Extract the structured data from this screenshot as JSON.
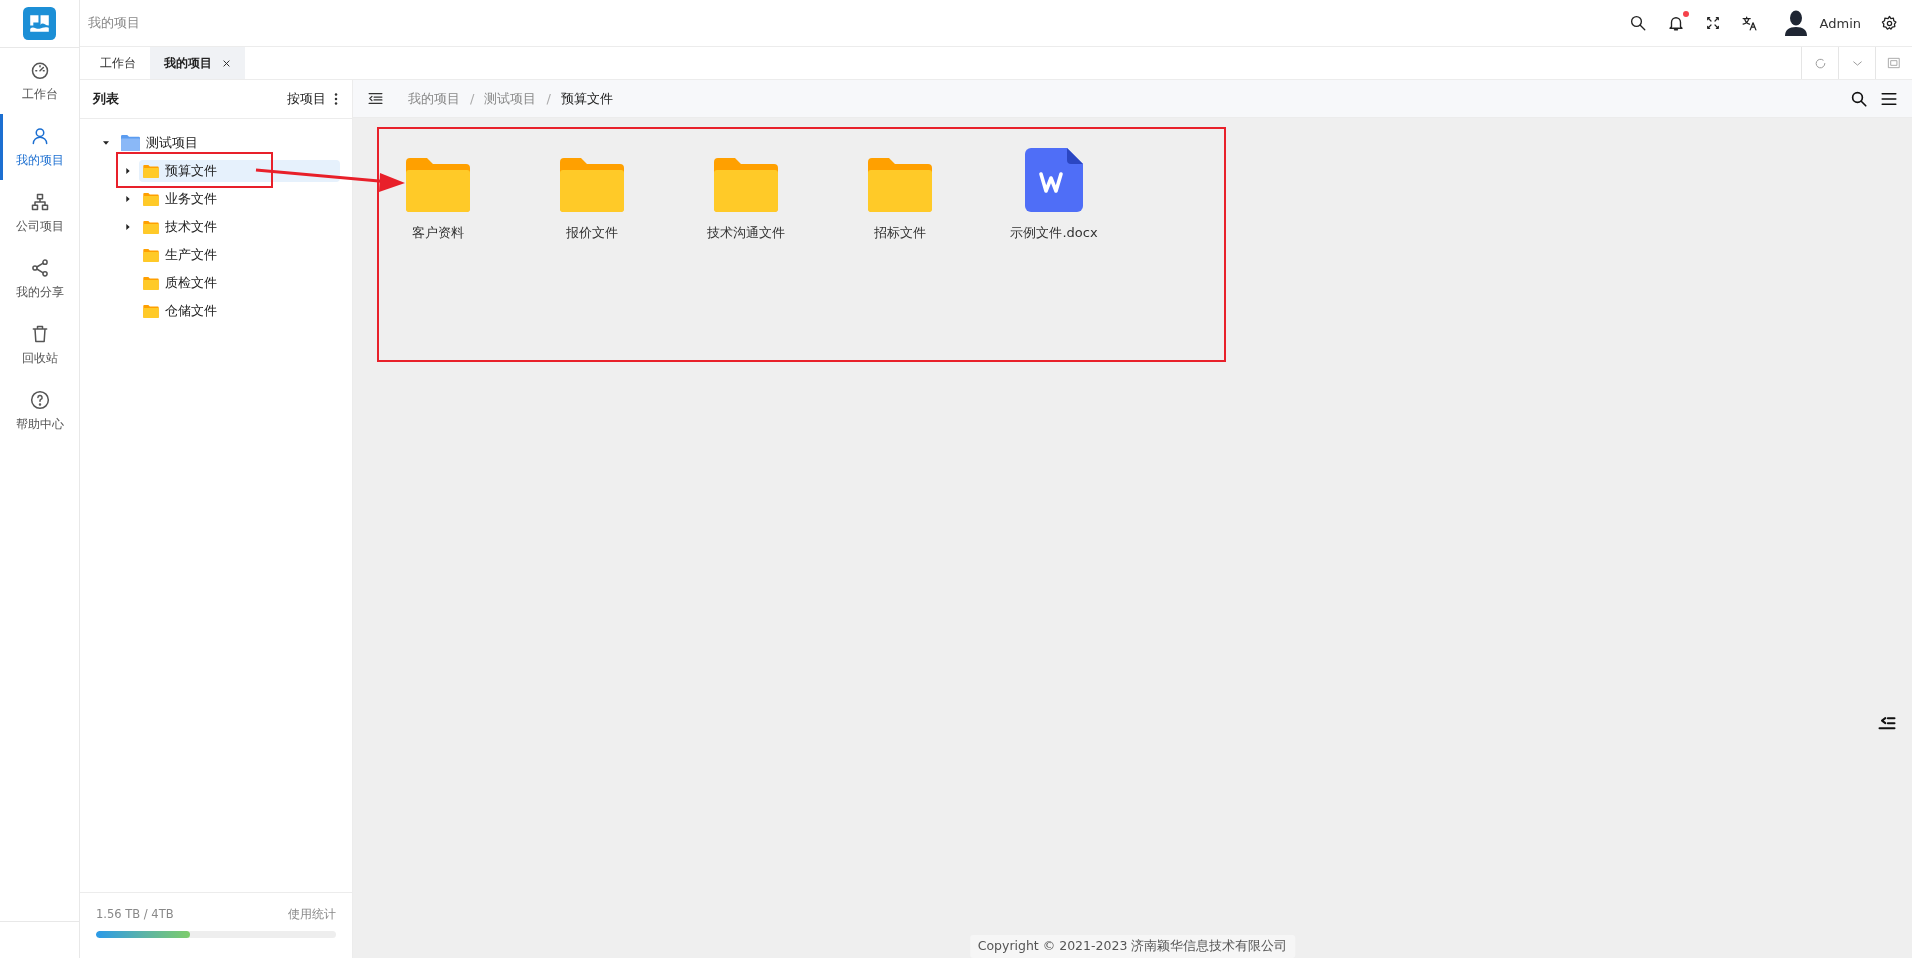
{
  "header": {
    "title": "我的项目",
    "notification_unread": true,
    "user_name": "Admin"
  },
  "sidebar": {
    "items": [
      {
        "label": "工作台",
        "selected": false
      },
      {
        "label": "我的项目",
        "selected": true
      },
      {
        "label": "公司项目",
        "selected": false
      },
      {
        "label": "我的分享",
        "selected": false
      },
      {
        "label": "回收站",
        "selected": false
      },
      {
        "label": "帮助中心",
        "selected": false
      }
    ]
  },
  "tabs": [
    {
      "label": "工作台",
      "selected": false,
      "closable": false
    },
    {
      "label": "我的项目",
      "selected": true,
      "closable": true
    }
  ],
  "tree_panel": {
    "title": "列表",
    "group_by": "按项目",
    "tree": [
      {
        "label": "测试项目",
        "kind": "project",
        "expanded": true,
        "selected": false,
        "children": [
          {
            "label": "预算文件",
            "kind": "branch",
            "expanded": false,
            "selected": true
          },
          {
            "label": "业务文件",
            "kind": "branch",
            "expanded": false,
            "selected": false
          },
          {
            "label": "技术文件",
            "kind": "branch",
            "expanded": false,
            "selected": false
          },
          {
            "label": "生产文件",
            "kind": "leaf",
            "selected": false
          },
          {
            "label": "质检文件",
            "kind": "leaf",
            "selected": false
          },
          {
            "label": "仓储文件",
            "kind": "leaf",
            "selected": false
          }
        ]
      }
    ],
    "storage": {
      "usage": "1.56 TB / 4TB",
      "link": "使用统计",
      "level": 0.39
    }
  },
  "breadcrumb": {
    "separator": "/",
    "items": [
      "我的项目",
      "测试项目",
      "预算文件"
    ]
  },
  "files": [
    {
      "name": "客户资料",
      "kind": "folder"
    },
    {
      "name": "报价文件",
      "kind": "folder"
    },
    {
      "name": "技术沟通文件",
      "kind": "folder"
    },
    {
      "name": "招标文件",
      "kind": "folder"
    },
    {
      "name": "示例文件.docx",
      "kind": "word"
    }
  ],
  "footer": {
    "copyright": "Copyright © 2021-2023 济南颖华信息技术有限公司"
  }
}
